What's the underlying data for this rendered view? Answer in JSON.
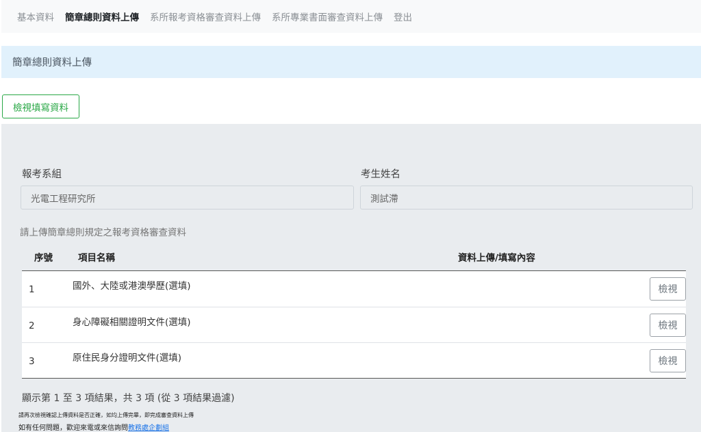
{
  "nav": {
    "items": [
      "基本資料",
      "簡章總則資料上傳",
      "系所報考資格審查資料上傳",
      "系所專業書面審查資料上傳",
      "登出"
    ],
    "active_index": 1
  },
  "alert": {
    "title": "簡章總則資料上傳"
  },
  "view_button": {
    "label": "檢視填寫資料"
  },
  "form": {
    "dept_label": "報考系組",
    "dept_value": "光電工程研究所",
    "name_label": "考生姓名",
    "name_value": "測試滯"
  },
  "hint": "請上傳簡章總則規定之報考資格審查資料",
  "table": {
    "headers": [
      "序號",
      "項目名稱",
      "資料上傳/填寫內容"
    ],
    "rows": [
      {
        "index": "1",
        "name": "國外、大陸或港澳學歷(選填)",
        "action": "檢視"
      },
      {
        "index": "2",
        "name": "身心障礙相關證明文件(選填)",
        "action": "檢視"
      },
      {
        "index": "3",
        "name": "原住民身分證明文件(選填)",
        "action": "檢視"
      }
    ]
  },
  "summary": "顯示第 1 至 3 項結果，共 3 項 (從 3 項結果過濾)",
  "notes": {
    "line1": "請再次檢視確認上傳資料是否正確，如均上傳完畢，即完成審查資料上傳",
    "line2_prefix": "如有任何問題，歡迎來電或來信詢問",
    "line2_link": "教務處企劃組"
  }
}
